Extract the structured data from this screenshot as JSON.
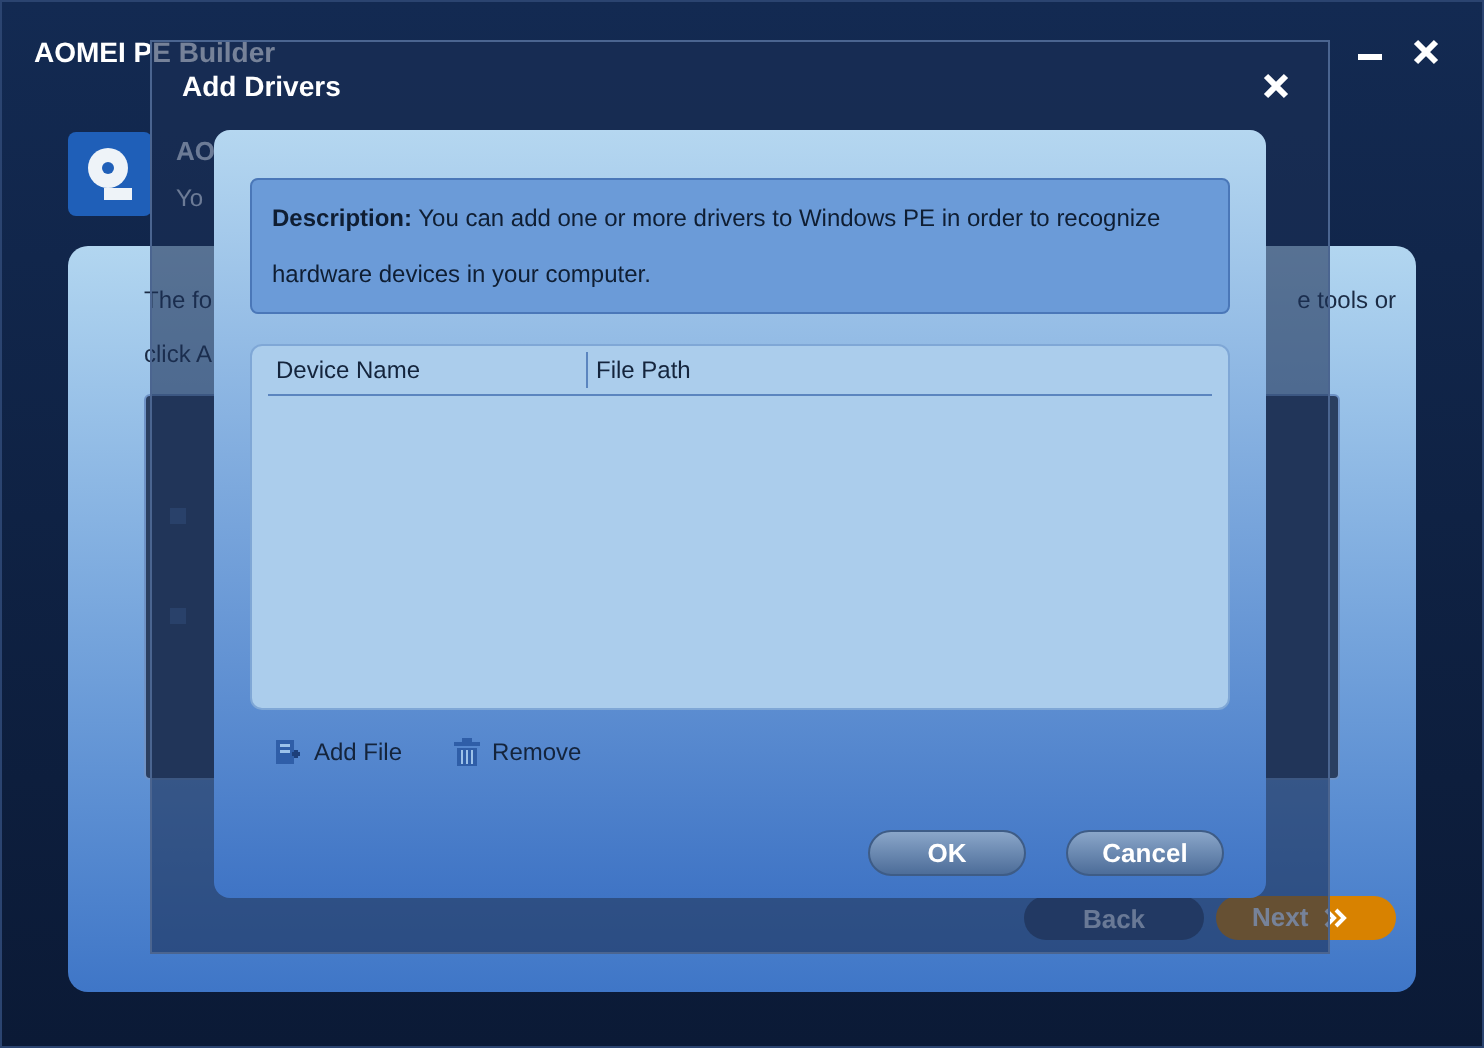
{
  "main_window": {
    "title": "AOMEI PE Builder",
    "header": {
      "title": "AO",
      "subtitle": "Yo"
    },
    "intro_lines": [
      {
        "start": "The fo",
        "end": "e tools or"
      },
      {
        "start": "click A"
      }
    ],
    "back_button": "Back",
    "next_button": "Next"
  },
  "dialog": {
    "title": "Add Drivers",
    "description": "**Description:** You can add one or more drivers to Windows PE in order to recognize hardware devices in your computer.",
    "columns": [
      "Device Name",
      "File Path"
    ],
    "actions": [
      {
        "label": "Add File",
        "kind": "add"
      },
      {
        "label": "Remove",
        "kind": "remove"
      }
    ],
    "buttons": [
      "OK",
      "Cancel"
    ]
  }
}
